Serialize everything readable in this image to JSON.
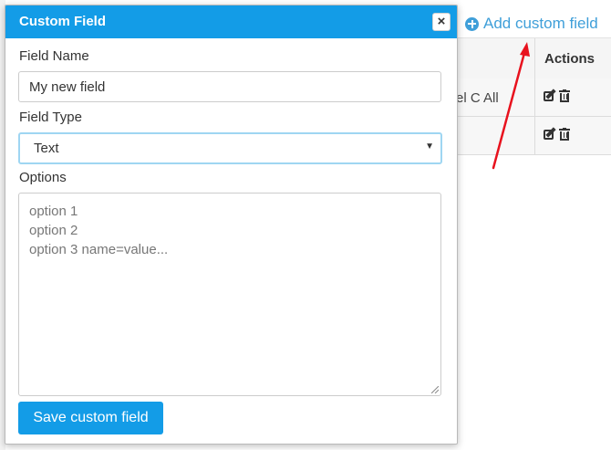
{
  "background": {
    "add_link_label": "Add custom field",
    "table": {
      "actions_header": "Actions",
      "rows": [
        {
          "cell": "el C All"
        },
        {
          "cell": ""
        }
      ]
    }
  },
  "modal": {
    "title": "Custom Field",
    "close_label": "×",
    "field_name": {
      "label": "Field Name",
      "value": "My new field"
    },
    "field_type": {
      "label": "Field Type",
      "selected": "Text"
    },
    "options": {
      "label": "Options",
      "placeholder_lines": [
        "option 1",
        "option 2",
        "option 3 name=value..."
      ]
    },
    "save_label": "Save custom field"
  },
  "colors": {
    "accent": "#139ce7",
    "link": "#3f9fd9",
    "annotation_arrow": "#e8121e"
  }
}
